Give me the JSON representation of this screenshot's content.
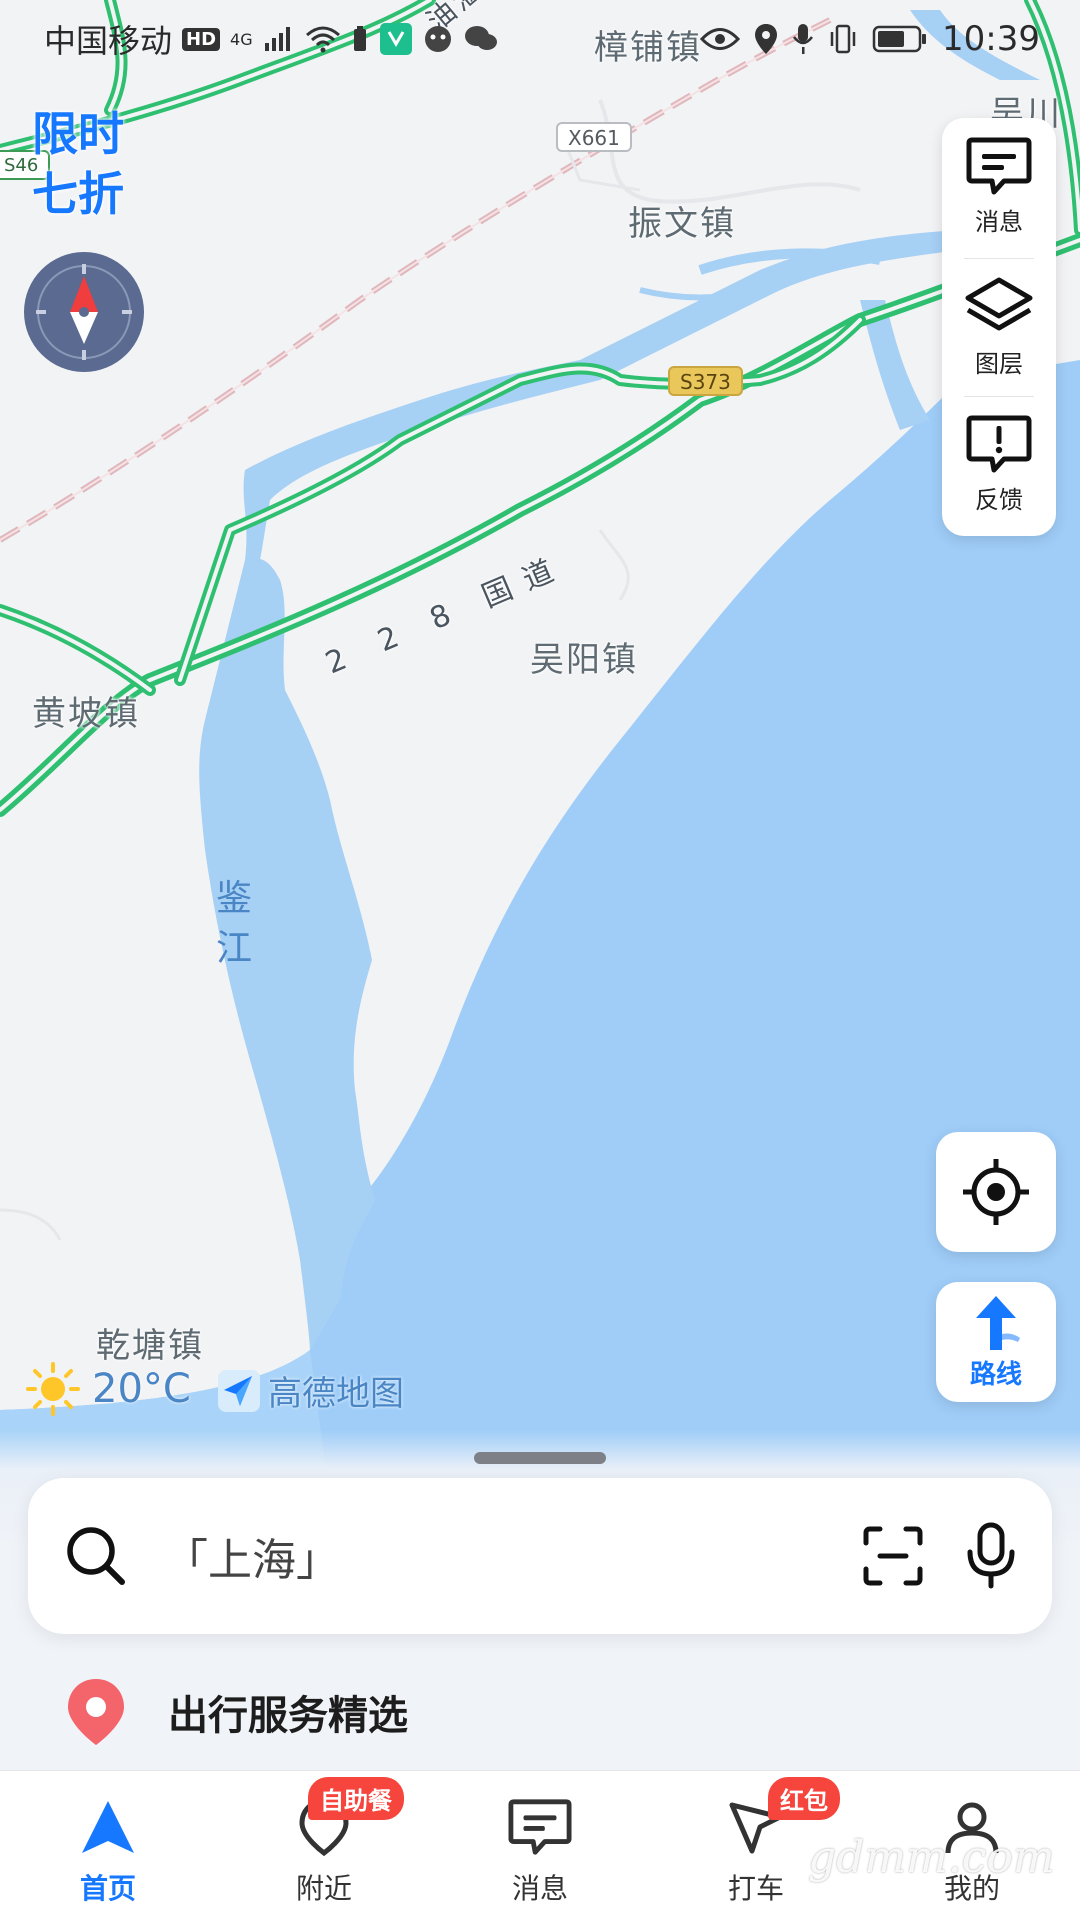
{
  "status_bar": {
    "carrier": "中国移动",
    "hd": "HD",
    "network": "4G",
    "time": "10:39"
  },
  "promo": {
    "line1": "限时",
    "line2": "七折"
  },
  "map": {
    "places": {
      "zhangpu": "樟铺镇",
      "zhenwen": "振文镇",
      "wuyang": "吴阳镇",
      "huangpo": "黄坡镇",
      "qiantang": "乾塘镇",
      "wuchuan": "吴川"
    },
    "water": {
      "jianjiang": "鉴江"
    },
    "road_names": {
      "g228": "2 2 8 国道",
      "partial_top": "油湛"
    },
    "shields": {
      "x661": "X661",
      "s373": "S373",
      "s46": "S46"
    },
    "colors": {
      "land": "#f2f3f5",
      "sea": "#9fcdf8",
      "river": "#a7d0f5",
      "highway": "#2fbf71"
    }
  },
  "tool_panel": {
    "messages": "消息",
    "layers": "图层",
    "feedback": "反馈"
  },
  "route_button": {
    "label": "路线"
  },
  "weather": {
    "temperature": "20°C",
    "icon": "sun-icon"
  },
  "brand": {
    "name": "高德地图"
  },
  "search": {
    "placeholder": "「上海」"
  },
  "service": {
    "title": "出行服务精选"
  },
  "tabs": [
    {
      "label": "首页",
      "active": true
    },
    {
      "label": "附近",
      "badge": "自助餐"
    },
    {
      "label": "消息"
    },
    {
      "label": "打车",
      "badge": "红包"
    },
    {
      "label": "我的"
    }
  ],
  "watermark": "gdmm.com",
  "accent_color": "#1677ff"
}
